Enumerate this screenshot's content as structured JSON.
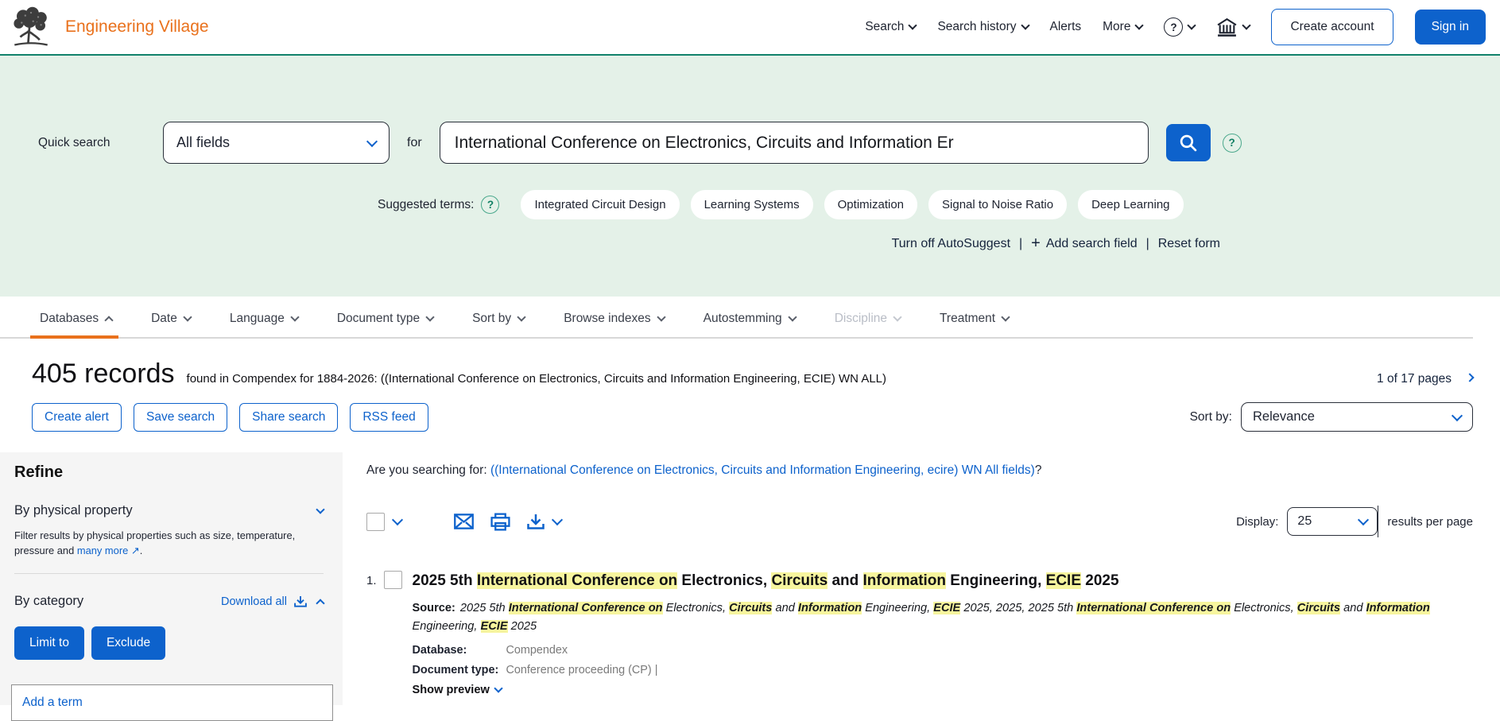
{
  "colors": {
    "accent_blue": "#0d62cc",
    "brand_orange": "#e9711c",
    "header_line_green": "#11826b",
    "search_band_green": "#e4f1e8",
    "highlight_yellow": "#f7f59e"
  },
  "icons": {
    "help_glyph": "?"
  },
  "header": {
    "brand": "Engineering Village",
    "nav": [
      {
        "label": "Search",
        "chevron": true
      },
      {
        "label": "Search history",
        "chevron": true
      },
      {
        "label": "Alerts",
        "chevron": false
      },
      {
        "label": "More",
        "chevron": true
      }
    ],
    "create_account_label": "Create account",
    "sign_in_label": "Sign in"
  },
  "quick_search": {
    "label": "Quick search",
    "field_selector_value": "All fields",
    "for_label": "for",
    "query_value": "International Conference on Electronics, Circuits and Information Er",
    "suggested_terms_label": "Suggested terms:",
    "suggested_terms": [
      "Integrated Circuit Design",
      "Learning Systems",
      "Optimization",
      "Signal to Noise Ratio",
      "Deep Learning"
    ],
    "autosuggest_label": "Turn off AutoSuggest",
    "separator": "|",
    "add_search_field_plus": "+",
    "add_search_field_label": "Add search field",
    "reset_form_label": "Reset form"
  },
  "filter_tabs": [
    {
      "label": "Databases",
      "class": "active"
    },
    {
      "label": "Date"
    },
    {
      "label": "Language"
    },
    {
      "label": "Document type"
    },
    {
      "label": "Sort by"
    },
    {
      "label": "Browse indexes"
    },
    {
      "label": "Autostemming"
    },
    {
      "label": "Discipline",
      "class": "disabled"
    },
    {
      "label": "Treatment"
    }
  ],
  "results_header": {
    "count": "405 records",
    "found_in": "found in Compendex for 1884-2026: ((International Conference on Electronics, Circuits and Information Engineering, ECIE) WN ALL)",
    "pagination": "1 of 17 pages",
    "actions": [
      "Create alert",
      "Save search",
      "Share search",
      "RSS feed"
    ],
    "sort_by_label": "Sort by:",
    "sort_by_value": "Relevance"
  },
  "sidebar": {
    "title": "Refine",
    "physical_property": {
      "title": "By physical property",
      "description_before": "Filter results by physical properties such as size, temperature, pressure and ",
      "link": "many more",
      "external_arrow": "↗",
      "description_after": "."
    },
    "category": {
      "title": "By category",
      "download_all_label": "Download all"
    },
    "limit_to_label": "Limit to",
    "exclude_label": "Exclude",
    "add_term_placeholder": "Add a term"
  },
  "main": {
    "searching_for_label": "Are you searching for: ",
    "searching_for_link": "((International Conference on Electronics, Circuits and Information Engineering, ecire) WN All fields)",
    "searching_for_suffix": "?",
    "display_label": "Display:",
    "display_value": "25",
    "results_per_page_label": "results per page",
    "results": [
      {
        "number": "1.",
        "title_segments": [
          {
            "t": "2025 5th ",
            "h": false
          },
          {
            "t": "International Conference on",
            "h": true
          },
          {
            "t": " Electronics, ",
            "h": false
          },
          {
            "t": "Circuits",
            "h": true
          },
          {
            "t": " and ",
            "h": false
          },
          {
            "t": "Information",
            "h": true
          },
          {
            "t": " Engineering, ",
            "h": false
          },
          {
            "t": "ECIE",
            "h": true
          },
          {
            "t": " 2025",
            "h": false
          }
        ],
        "source_label": "Source:",
        "source_segments": [
          {
            "t": "2025 5th ",
            "h": false
          },
          {
            "t": "International Conference on",
            "h": true
          },
          {
            "t": " Electronics, ",
            "h": false
          },
          {
            "t": "Circuits",
            "h": true
          },
          {
            "t": " and ",
            "h": false
          },
          {
            "t": "Information",
            "h": true
          },
          {
            "t": " Engineering, ",
            "h": false
          },
          {
            "t": "ECIE",
            "h": true
          },
          {
            "t": " 2025, 2025, 2025 5th ",
            "h": false
          },
          {
            "t": "International Conference on",
            "h": true
          },
          {
            "t": " Electronics, ",
            "h": false
          },
          {
            "t": "Circuits",
            "h": true
          },
          {
            "t": " and ",
            "h": false
          },
          {
            "t": "Information",
            "h": true
          },
          {
            "t": " Engineering, ",
            "h": false
          },
          {
            "t": "ECIE",
            "h": true
          },
          {
            "t": " 2025",
            "h": false
          }
        ],
        "database_label": "Database:",
        "database_value": "Compendex",
        "doctype_label": "Document type:",
        "doctype_value": "Conference proceeding (CP) |",
        "show_preview_label": "Show preview"
      }
    ]
  }
}
